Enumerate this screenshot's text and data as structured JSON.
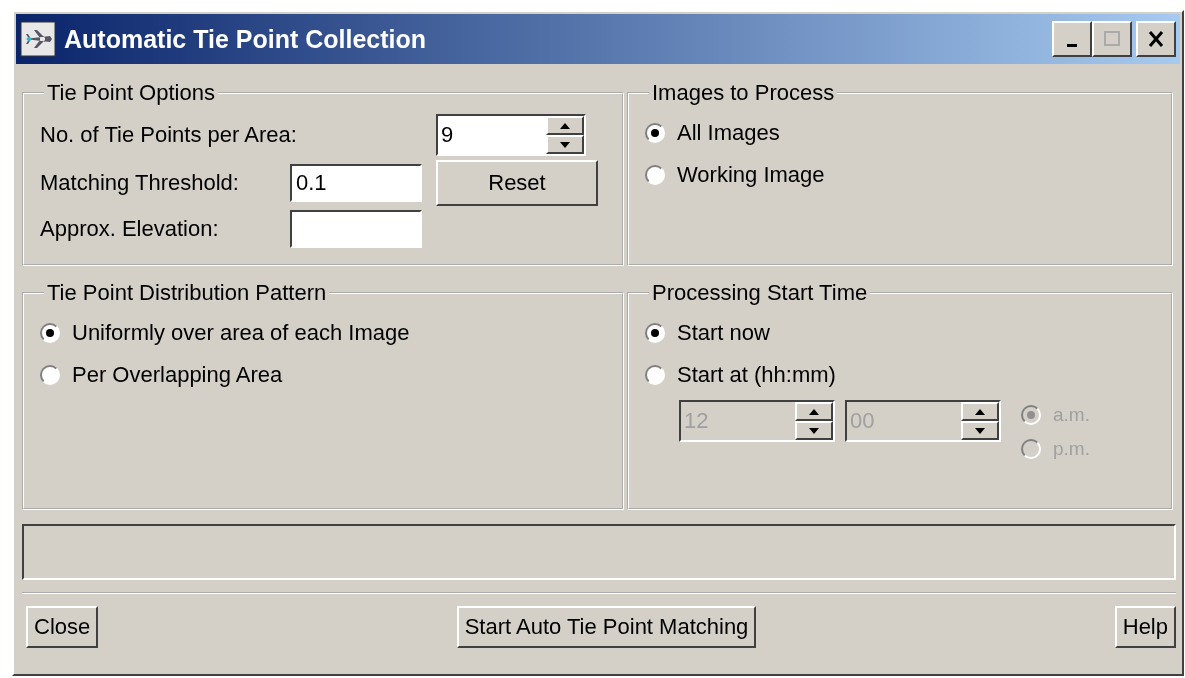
{
  "window": {
    "title": "Automatic Tie Point Collection"
  },
  "tie_point_options": {
    "title": "Tie Point Options",
    "fields": [
      {
        "kind": "spinner",
        "label": "No. of Tie Points per Area:",
        "value": "9"
      },
      {
        "kind": "text",
        "label": "Matching Threshold:",
        "value": "0.1"
      },
      {
        "kind": "text",
        "label": "Approx. Elevation:"
      }
    ],
    "reset_button": "Reset"
  },
  "images_to_process": {
    "title": "Images to Process",
    "options": [
      {
        "label": "All Images",
        "selected": true
      },
      {
        "label": "Working Image",
        "selected": false
      }
    ]
  },
  "distribution_pattern": {
    "title": "Tie Point Distribution Pattern",
    "options": [
      {
        "label": "Uniformly over area of each Image",
        "selected": true
      },
      {
        "label": "Per Overlapping Area",
        "selected": false
      }
    ]
  },
  "start_time": {
    "title": "Processing Start Time",
    "options": [
      {
        "label": "Start now",
        "selected": true
      },
      {
        "label": "Start at (hh:mm)",
        "selected": false
      }
    ],
    "hour": {
      "value": "12",
      "disabled": true
    },
    "minute": {
      "value": "00",
      "disabled": true
    },
    "meridiem": [
      {
        "label": "a.m.",
        "selected": true,
        "disabled": true
      },
      {
        "label": "p.m.",
        "selected": false,
        "disabled": true
      }
    ]
  },
  "buttons": [
    "Close",
    "Start Auto Tie Point Matching",
    "Help"
  ]
}
